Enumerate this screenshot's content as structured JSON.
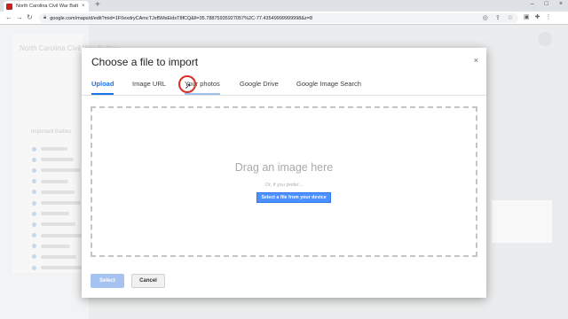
{
  "browser": {
    "tab_title": "North Carolina Civil War Battles",
    "tab_close": "×",
    "new_tab": "+",
    "url": "google.com/maps/d/edit?mid=1F0exdryCAmcTJsf5MsEidsT8fCQ&ll=35.78875935927057%2C-77.43549999999998&z=8",
    "win_controls": [
      "–",
      "□",
      "×"
    ]
  },
  "background_page": {
    "map_title": "North Carolina Civil War Battles",
    "layer_heading": "Important Battles",
    "pins_count": 12
  },
  "dialog": {
    "title": "Choose a file to import",
    "close": "×",
    "tabs": [
      {
        "label": "Upload",
        "active": true
      },
      {
        "label": "Image URL",
        "active": false
      },
      {
        "label": "Your photos",
        "active": false,
        "hovered": true
      },
      {
        "label": "Google Drive",
        "active": false
      },
      {
        "label": "Google Image Search",
        "active": false
      }
    ],
    "drop_text": "Drag an image here",
    "or_text": "Or, if you prefer...",
    "select_device_label": "Select a file from your device",
    "select_label": "Select",
    "cancel_label": "Cancel"
  },
  "colors": {
    "accent": "#1a73e8",
    "device_button": "#4d90fe",
    "click_ring": "#d93025"
  }
}
